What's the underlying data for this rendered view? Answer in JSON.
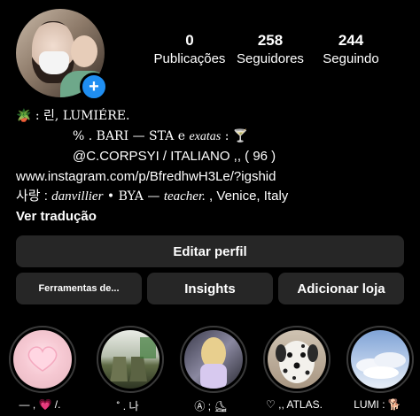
{
  "stats": [
    {
      "num": "0",
      "label": "Publicações"
    },
    {
      "num": "258",
      "label": "Seguidores"
    },
    {
      "num": "244",
      "label": "Seguindo"
    }
  ],
  "bio": {
    "line1": "🪴 : 린, LUMIÉRE.",
    "line2_a": "% . BARI — STA e ",
    "line2_b": "exatas",
    "line2_c": " : 🍸",
    "line3": "@C.CORPSYI / ITALIANO ,, ( 96 )",
    "line4": "www.instagram.com/p/BfredhwH3Le/?igshid",
    "line5_a": "사랑 : ",
    "line5_b": "danvillier",
    "line5_c": " • BYA — ",
    "line5_d": "teacher.",
    "line5_e": " , Venice, Italy",
    "translate": "Ver tradução"
  },
  "buttons": {
    "edit_profile": "Editar perfil",
    "tools": "Ferramentas de...",
    "insights": "Insights",
    "add_shop": "Adicionar loja"
  },
  "stories": [
    {
      "caption": "— , 💗 /."
    },
    {
      "caption": "˚ . 나"
    },
    {
      "caption": "Ⓐ ; ⛸"
    },
    {
      "caption": "♡ ,, ATLAS."
    },
    {
      "caption": "LUMI : 🐕"
    }
  ],
  "colors": {
    "background": "#000000",
    "button": "#262626",
    "badge": "#1f8ef1"
  }
}
